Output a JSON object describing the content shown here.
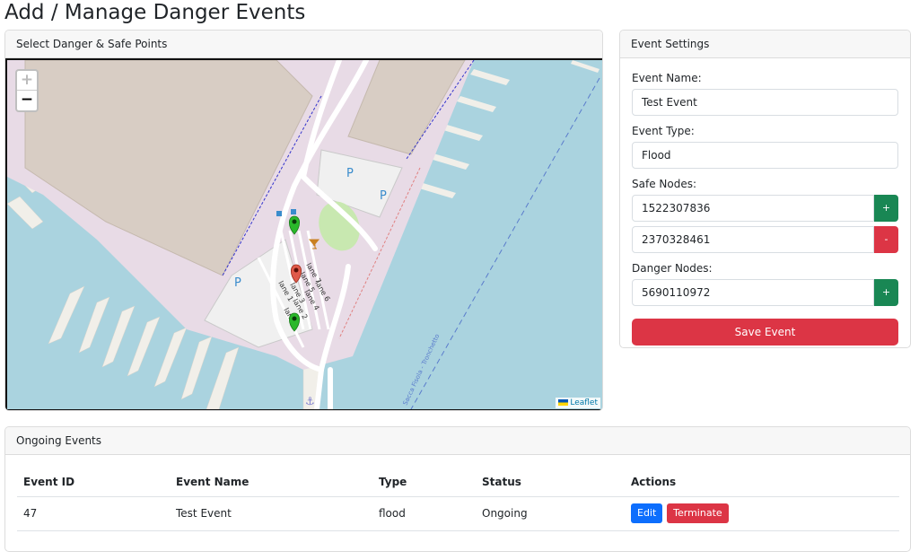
{
  "page": {
    "title": "Add / Manage Danger Events"
  },
  "map_panel": {
    "header": "Select Danger & Safe Points",
    "zoom_in": "+",
    "zoom_out": "−",
    "attribution": "Leaflet",
    "labels": {
      "parking": "P",
      "lanes": [
        "lane 7",
        "lane 6",
        "lane 5",
        "lane 4",
        "lane 3",
        "lane 2",
        "lane 1",
        "lane 2"
      ],
      "canal": "Sacca Fisola - Tronchetto"
    },
    "colors": {
      "water": "#aad3df",
      "land": "#e8dbe6",
      "building": "#d8cdc4",
      "safe_marker": "#2ab82a",
      "danger_marker": "#e05a4a"
    }
  },
  "settings": {
    "header": "Event Settings",
    "name_label": "Event Name:",
    "name_value": "Test Event",
    "type_label": "Event Type:",
    "type_value": "Flood",
    "safe_label": "Safe Nodes:",
    "safe_nodes": [
      {
        "value": "1522307836",
        "action": "+"
      },
      {
        "value": "2370328461",
        "action": "-"
      }
    ],
    "danger_label": "Danger Nodes:",
    "danger_nodes": [
      {
        "value": "5690110972",
        "action": "+"
      }
    ],
    "save_label": "Save Event"
  },
  "events": {
    "header": "Ongoing Events",
    "columns": [
      "Event ID",
      "Event Name",
      "Type",
      "Status",
      "Actions"
    ],
    "rows": [
      {
        "id": "47",
        "name": "Test Event",
        "type": "flood",
        "status": "Ongoing",
        "edit": "Edit",
        "terminate": "Terminate"
      }
    ]
  }
}
